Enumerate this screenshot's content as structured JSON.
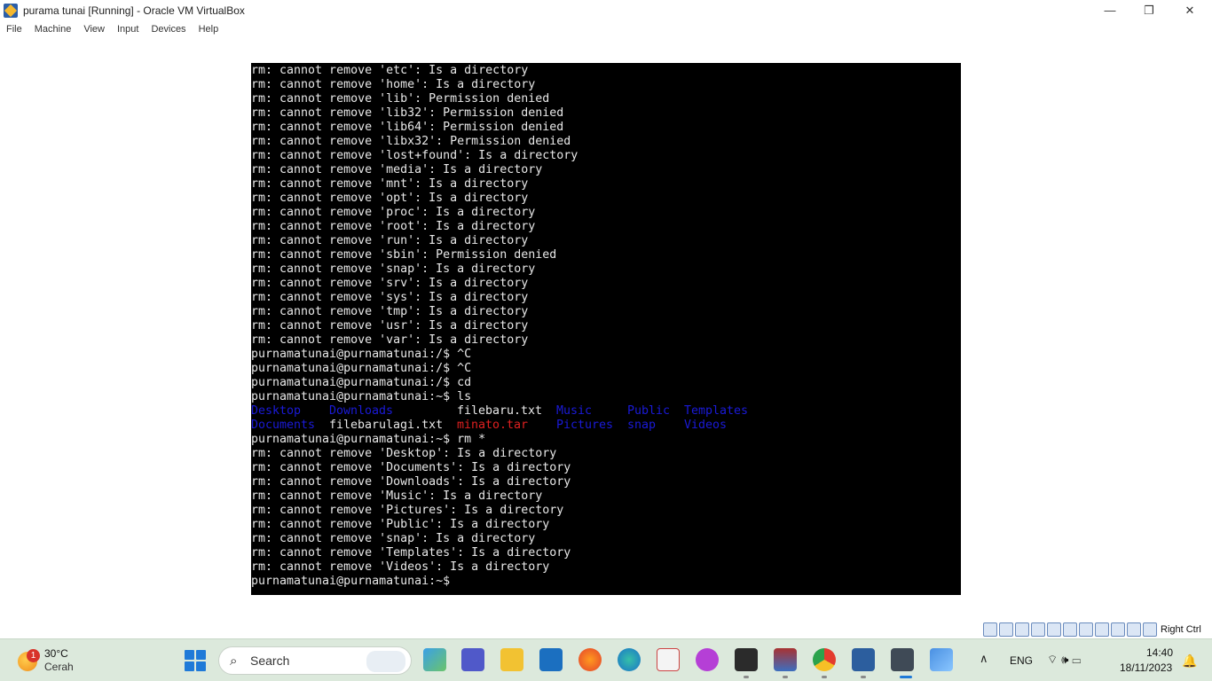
{
  "window": {
    "title": "purama tunai [Running] - Oracle VM VirtualBox",
    "controls": {
      "minimize": "—",
      "restore": "❐",
      "close": "✕"
    }
  },
  "menu": [
    "File",
    "Machine",
    "View",
    "Input",
    "Devices",
    "Help"
  ],
  "terminal": {
    "lines_before_ls": [
      "rm: cannot remove 'etc': Is a directory",
      "rm: cannot remove 'home': Is a directory",
      "rm: cannot remove 'lib': Permission denied",
      "rm: cannot remove 'lib32': Permission denied",
      "rm: cannot remove 'lib64': Permission denied",
      "rm: cannot remove 'libx32': Permission denied",
      "rm: cannot remove 'lost+found': Is a directory",
      "rm: cannot remove 'media': Is a directory",
      "rm: cannot remove 'mnt': Is a directory",
      "rm: cannot remove 'opt': Is a directory",
      "rm: cannot remove 'proc': Is a directory",
      "rm: cannot remove 'root': Is a directory",
      "rm: cannot remove 'run': Is a directory",
      "rm: cannot remove 'sbin': Permission denied",
      "rm: cannot remove 'snap': Is a directory",
      "rm: cannot remove 'srv': Is a directory",
      "rm: cannot remove 'sys': Is a directory",
      "rm: cannot remove 'tmp': Is a directory",
      "rm: cannot remove 'usr': Is a directory",
      "rm: cannot remove 'var': Is a directory",
      "purnamatunai@purnamatunai:/$ ^C",
      "purnamatunai@purnamatunai:/$ ^C",
      "purnamatunai@purnamatunai:/$ cd",
      "purnamatunai@purnamatunai:~$ ls"
    ],
    "ls_row1": [
      "Desktop",
      "Downloads",
      "filebaru.txt",
      "Music",
      "Public",
      "Templates"
    ],
    "ls_row2": [
      "Documents",
      "filebarulagi.txt",
      "minato.tar",
      "Pictures",
      "snap",
      "Videos"
    ],
    "lines_after_ls": [
      "purnamatunai@purnamatunai:~$ rm *",
      "rm: cannot remove 'Desktop': Is a directory",
      "rm: cannot remove 'Documents': Is a directory",
      "rm: cannot remove 'Downloads': Is a directory",
      "rm: cannot remove 'Music': Is a directory",
      "rm: cannot remove 'Pictures': Is a directory",
      "rm: cannot remove 'Public': Is a directory",
      "rm: cannot remove 'snap': Is a directory",
      "rm: cannot remove 'Templates': Is a directory",
      "rm: cannot remove 'Videos': Is a directory",
      "purnamatunai@purnamatunai:~$"
    ],
    "colors": {
      "directory": "#1a1ad8",
      "file": "#e8e8e8",
      "archive": "#e02020",
      "background": "#000000"
    }
  },
  "statusbar": {
    "host_key": "Right Ctrl"
  },
  "taskbar": {
    "weather": {
      "badge": "1",
      "temp": "30°C",
      "desc": "Cerah"
    },
    "search_label": "Search",
    "tray": {
      "chevron": "∧",
      "language": "ENG",
      "icons": "⌔🕪▭",
      "time": "14:40",
      "date": "18/11/2023",
      "bell": "🔔"
    }
  }
}
